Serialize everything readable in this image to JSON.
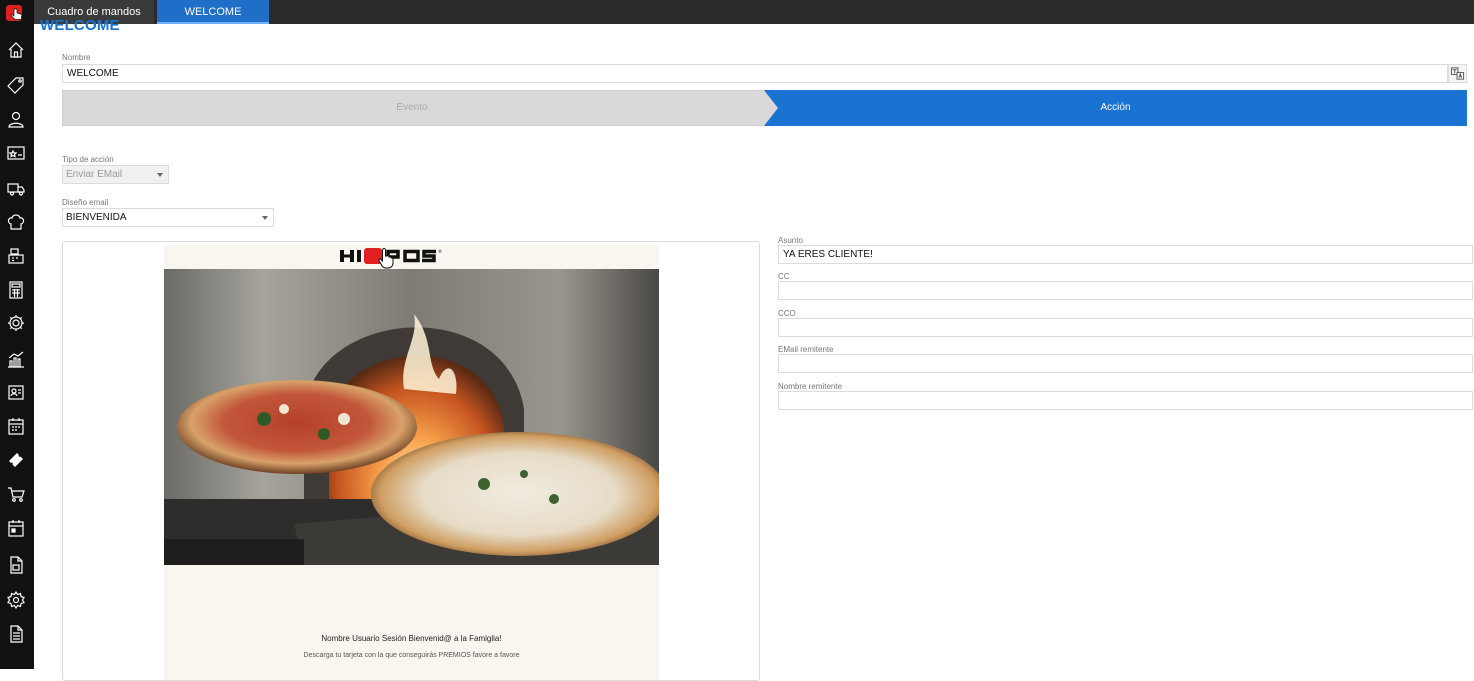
{
  "tabs": [
    {
      "label": "Cuadro de mandos"
    },
    {
      "label": "WELCOME"
    }
  ],
  "page": {
    "title": "WELCOME"
  },
  "nombre": {
    "label": "Nombre",
    "value": "WELCOME"
  },
  "stepper": {
    "step1": "Evento",
    "step2": "Acción"
  },
  "tipo_accion": {
    "label": "Tipo de acción",
    "value": "Enviar EMail"
  },
  "diseno_email": {
    "label": "Diseño email",
    "value": "BIENVENIDA"
  },
  "email_preview": {
    "brand": "HIOPOS",
    "line1": "Nombre Usuario Sesión Bienvenid@ a la Famiglia!",
    "line2": "Descarga tu tarjeta con la que conseguirás PREMIOS favore a favore"
  },
  "form": {
    "asunto_label": "Asunto",
    "asunto_value": "YA ERES CLIENTE!",
    "cc_label": "CC",
    "cc_value": "",
    "cco_label": "CCO",
    "cco_value": "",
    "email_remitente_label": "EMail remitente",
    "email_remitente_value": "",
    "nombre_remitente_label": "Nombre remitente",
    "nombre_remitente_value": ""
  },
  "colors": {
    "accent": "#1a73d2",
    "sidebar": "#111111",
    "topbar": "#2b2b2b",
    "step_inactive": "#d9d9d9",
    "brand_red": "#e02020"
  },
  "sidebar_icons": [
    "home-icon",
    "tag-icon",
    "customers-icon",
    "loyalty-card-icon",
    "delivery-truck-icon",
    "chef-hat-icon",
    "cash-register-icon",
    "calculator-icon",
    "settings-cog-icon",
    "sales-chart-icon",
    "employee-badge-icon",
    "calendar-icon",
    "ticket-icon",
    "cart-icon",
    "agenda-icon",
    "report-icon",
    "config-gear-icon",
    "document-icon"
  ]
}
